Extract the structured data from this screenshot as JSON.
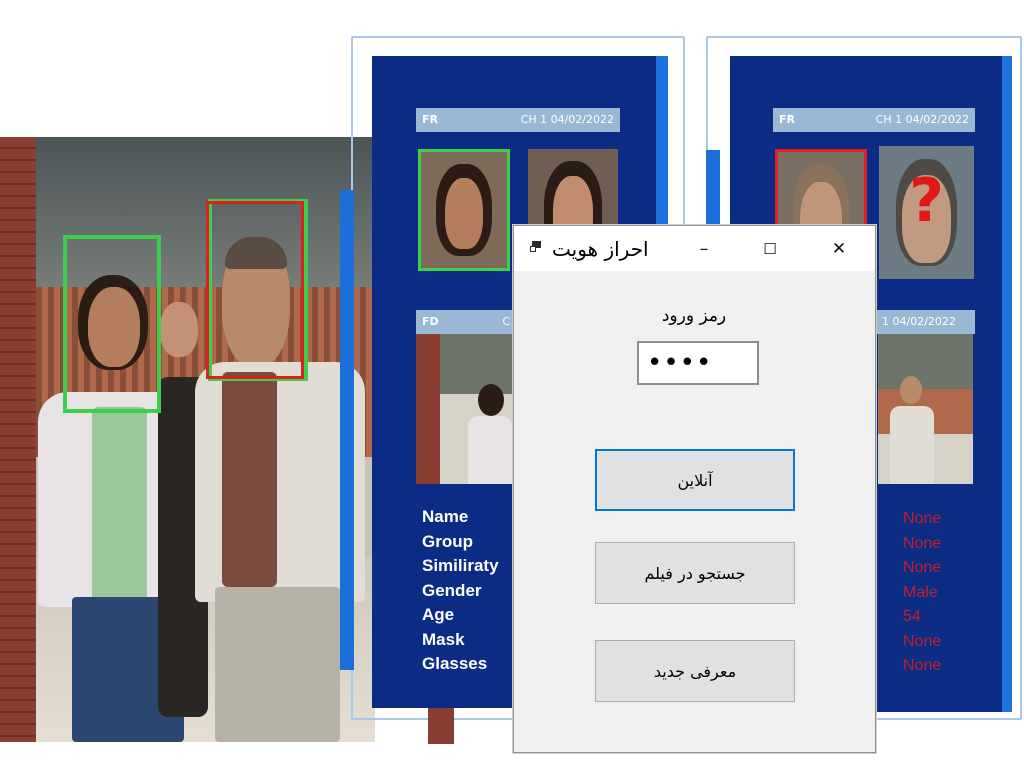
{
  "dialog": {
    "title": "احراز هویت",
    "password_label": "رمز ورود",
    "password_value": "••••",
    "buttons": {
      "online": "آنلاین",
      "search_film": "جستجو در فیلم",
      "register_new": "معرفی جدید"
    },
    "controls": {
      "minimize": "–",
      "maximize": "☐",
      "close": "✕"
    }
  },
  "monitor_left": {
    "cam_fr": {
      "label": "FR",
      "info": "CH 1  04/02/2022"
    },
    "cam_fd": {
      "label": "FD",
      "info": "C"
    },
    "fields": [
      "Name",
      "Group",
      "Similiraty",
      "Gender",
      "Age",
      "Mask",
      "Glasses"
    ]
  },
  "monitor_right": {
    "cam_fr": {
      "label": "FR",
      "info": "CH 1  04/02/2022"
    },
    "cam_fd": {
      "info": "1  04/02/2022"
    },
    "unknown_mark": "?",
    "values": [
      "None",
      "None",
      "None",
      "Male",
      "54",
      "None",
      "None"
    ]
  },
  "colors": {
    "match_box": "#3cd04a",
    "nomatch_box": "#e02020",
    "panel_blue": "#0b2b85",
    "value_red": "#c0202a",
    "focus_blue": "#0078d7"
  }
}
